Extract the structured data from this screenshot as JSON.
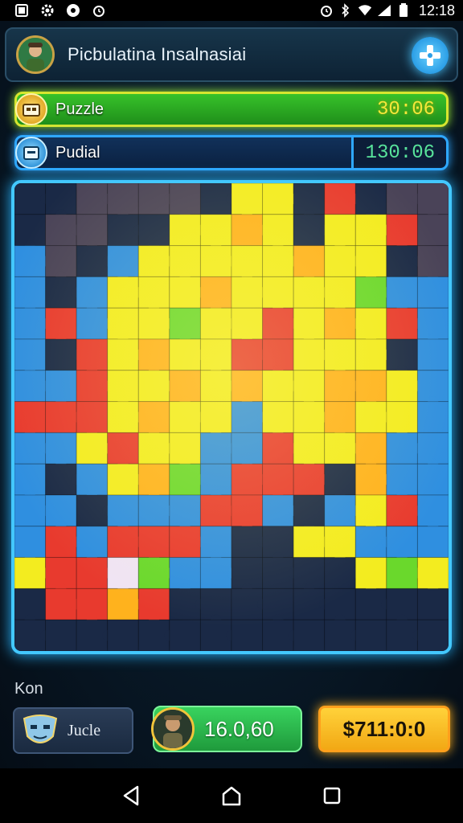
{
  "status_bar": {
    "time": "12:18",
    "left_icons": [
      "image-icon",
      "gear-icon",
      "app-icon",
      "alarm-icon"
    ],
    "right_icons": [
      "alarm-icon",
      "bluetooth-icon",
      "wifi-icon",
      "signal-icon",
      "battery-icon"
    ]
  },
  "header": {
    "title": "Picbulatina Insalnasiai"
  },
  "bars": {
    "puzzle": {
      "label": "Puzzle",
      "time": "30:06"
    },
    "pudial": {
      "label": "Pudial",
      "time": "130:06"
    }
  },
  "footer": {
    "section_label": "Kon",
    "card_label": "Jucle",
    "score": "16.0,60",
    "price": "$711:0:0"
  },
  "colors": {
    "accent_cyan": "#43c8ff",
    "green": "#37c22a",
    "yellow": "#ffd23a"
  }
}
